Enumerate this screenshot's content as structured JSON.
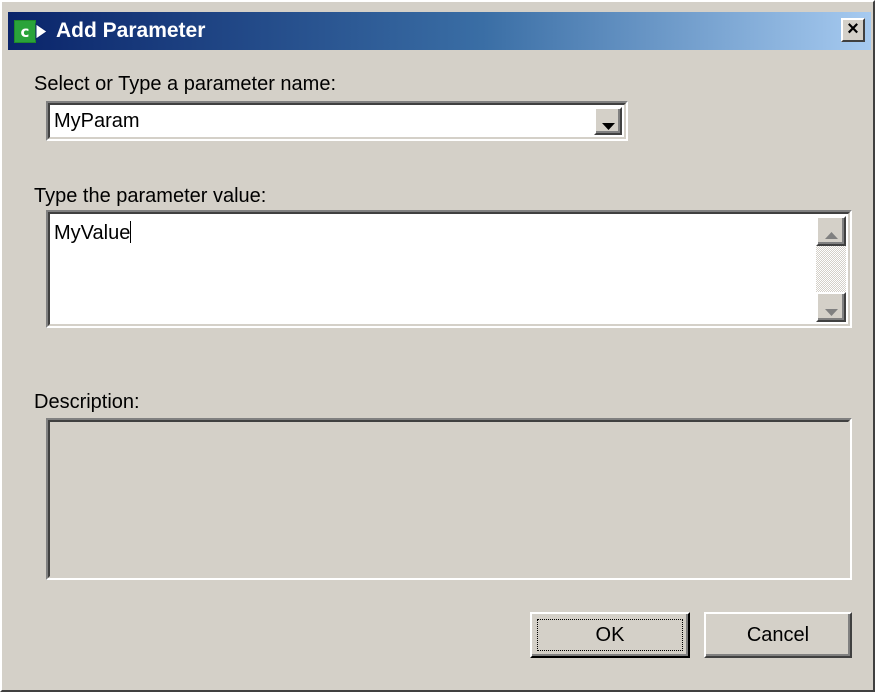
{
  "window": {
    "title": "Add Parameter",
    "close_glyph": "×"
  },
  "param_name": {
    "label": "Select or Type a parameter name:",
    "value": "MyParam",
    "dropdown_icon": "chevron-down-icon"
  },
  "param_value": {
    "label": "Type the parameter value:",
    "value": "MyValue"
  },
  "description": {
    "label": "Description:",
    "value": ""
  },
  "buttons": {
    "ok_label": "OK",
    "cancel_label": "Cancel"
  },
  "colors": {
    "titlebar_start": "#0a246a",
    "titlebar_end": "#a6caf0",
    "dialog_face": "#d4d0c8",
    "field_bg": "#ffffff",
    "icon_green": "#1f8a2a"
  }
}
